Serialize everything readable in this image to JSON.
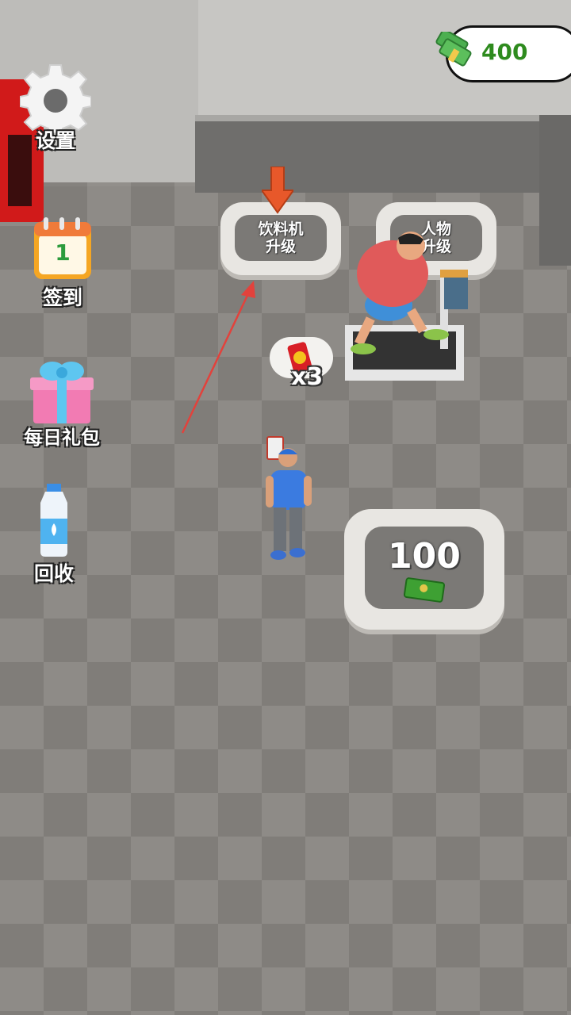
{
  "hud": {
    "money": "400",
    "settings_label": "设置",
    "checkin_label": "签到",
    "checkin_day": "1",
    "daily_gift_label": "每日礼包",
    "recycle_label": "回收"
  },
  "world": {
    "drink_upgrade_label": "饮料机\n升级",
    "character_upgrade_label": "人物\n升级",
    "unlock_cost": "100",
    "drink_count": "x3"
  },
  "colors": {
    "money_text": "#2e8b1e",
    "guide_arrow": "#e2423c",
    "marker_arrow": "#e8582a"
  }
}
